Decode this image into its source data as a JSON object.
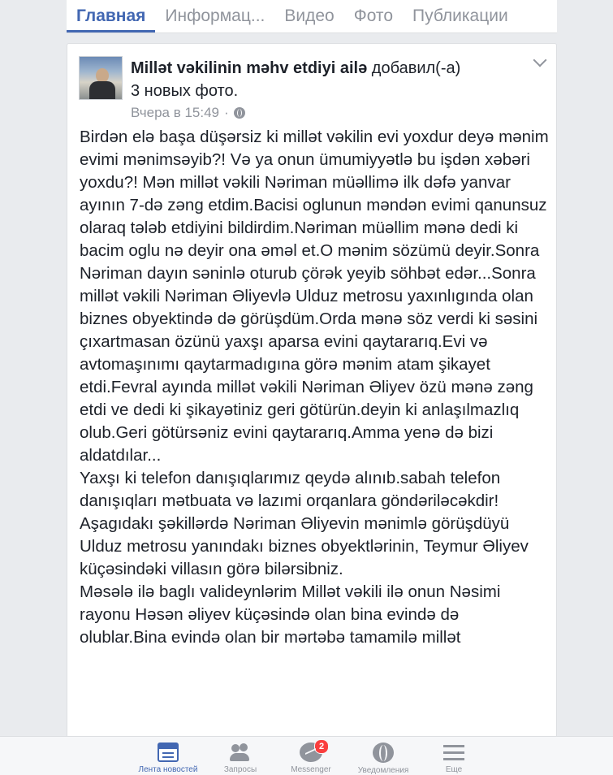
{
  "tabs": [
    {
      "label": "Главная",
      "active": true
    },
    {
      "label": "Информац..."
    },
    {
      "label": "Видео"
    },
    {
      "label": "Фото"
    },
    {
      "label": "Публикации"
    }
  ],
  "post": {
    "page_name": "Millət vəkilinin məhv etdiyi ailə",
    "action": "добавил(-а)",
    "subtitle": "3 новых фото.",
    "timestamp": "Вчера в 15:49",
    "separator": "·",
    "paragraphs": [
      "Birdən elə başa düşərsiz ki millət vəkilin evi yoxdur deyə mənim evimi mənimsəyib?! Və ya onun ümumiyyətlə bu işdən xəbəri yoxdu?! Mən millət vəkili Nəriman müəllimə ilk dəfə yanvar ayının 7-də zəng etdim.Bacisi oglunun məndən evimi qanunsuz olaraq tələb etdiyini bildirdim.Nəriman müəllim mənə dedi ki bacim oglu nə deyir ona əməl et.O mənim sözümü deyir.Sonra Nəriman dayın səninlə oturub çörək yeyib söhbət edər...Sonra millət vəkili Nəriman Əliyevlə Ulduz metrosu yaxınlıgında olan biznes obyektində də görüşdüm.Orda mənə söz verdi ki səsini çıxartmasan özünü yaxşı aparsa evini qaytararıq.Evi və avtomaşınımı qaytarmadıgına görə mənim atam şikayet etdi.Fevral ayında millət vəkili Nəriman Əliyev özü mənə zəng etdi ve dedi ki şikayətiniz geri götürün.deyin ki anlaşılmazlıq olub.Geri götürsəniz evini qaytararıq.Amma yenə də bizi aldatdılar...",
      "Yaxşı ki telefon danışıqlarımız qeydə alınıb.sabah telefon danışıqları mətbuata və lazımi orqanlara göndəriləcəkdir!",
      "Aşagıdakı şəkillərdə Nəriman Əliyevin mənimlə görüşdüyü Ulduz metrosu yanındakı biznes obyektlərinin, Teymur Əliyev küçəsindəki villasın görə bilərsibniz.",
      "Məsələ ilə baglı valideynlərim Millət vəkili ilə onun Nəsimi rayonu Həsən əliyev küçəsində olan bina evində də olublar.Bina evində olan bir mərtəbə tamamilə millət"
    ]
  },
  "bottom_nav": [
    {
      "label": "Лента новостей",
      "icon": "news-feed-icon",
      "active": true
    },
    {
      "label": "Запросы",
      "icon": "friend-requests-icon"
    },
    {
      "label": "Messenger",
      "icon": "messenger-icon",
      "badge": "2"
    },
    {
      "label": "Уведомления",
      "icon": "globe-notifications-icon"
    },
    {
      "label": "Еще",
      "icon": "menu-icon"
    }
  ],
  "colors": {
    "accent": "#4267b2",
    "badge": "#fa3e3e",
    "muted": "#90949c"
  }
}
